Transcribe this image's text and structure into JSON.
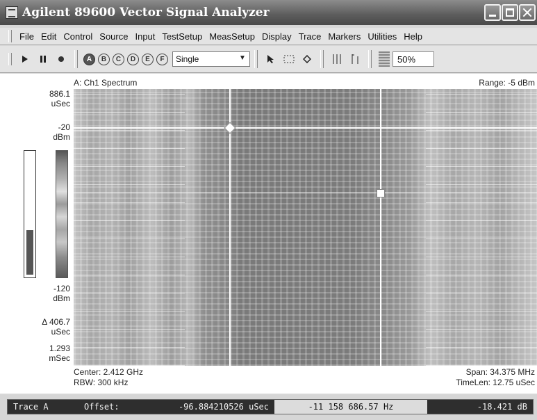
{
  "window": {
    "title": "Agilent 89600 Vector Signal Analyzer"
  },
  "menu": {
    "items": [
      "File",
      "Edit",
      "Control",
      "Source",
      "Input",
      "TestSetup",
      "MeasSetup",
      "Display",
      "Trace",
      "Markers",
      "Utilities",
      "Help"
    ]
  },
  "toolbar": {
    "trace_buttons": [
      "A",
      "B",
      "C",
      "D",
      "E",
      "F"
    ],
    "active_trace": "A",
    "mode_select": "Single",
    "zoom": "50%"
  },
  "trace": {
    "title": "A: Ch1 Spectrum",
    "range": "Range: -5 dBm",
    "y_top_value": "886.1",
    "y_top_unit": "uSec",
    "scale_top_value": "-20",
    "scale_top_unit": "dBm",
    "scale_bottom_value": "-120",
    "scale_bottom_unit": "dBm",
    "delta_value": "Δ 406.7",
    "delta_unit": "uSec",
    "y_bottom_value": "1.293",
    "y_bottom_unit": "mSec",
    "center": "Center: 2.412 GHz",
    "rbw": "RBW: 300 kHz",
    "span": "Span: 34.375 MHz",
    "timelen": "TimeLen: 12.75 uSec",
    "signal_level_fraction": 0.35
  },
  "status": {
    "trace_label": "Trace A",
    "offset_label": "Offset:",
    "offset_value": "-96.884210526 uSec",
    "frequency": "-11 158 686.57 Hz",
    "level": "-18.421 dB"
  },
  "colors": {
    "title_bar": "#5c5c5c",
    "status_dark": "#2e2e2e"
  }
}
